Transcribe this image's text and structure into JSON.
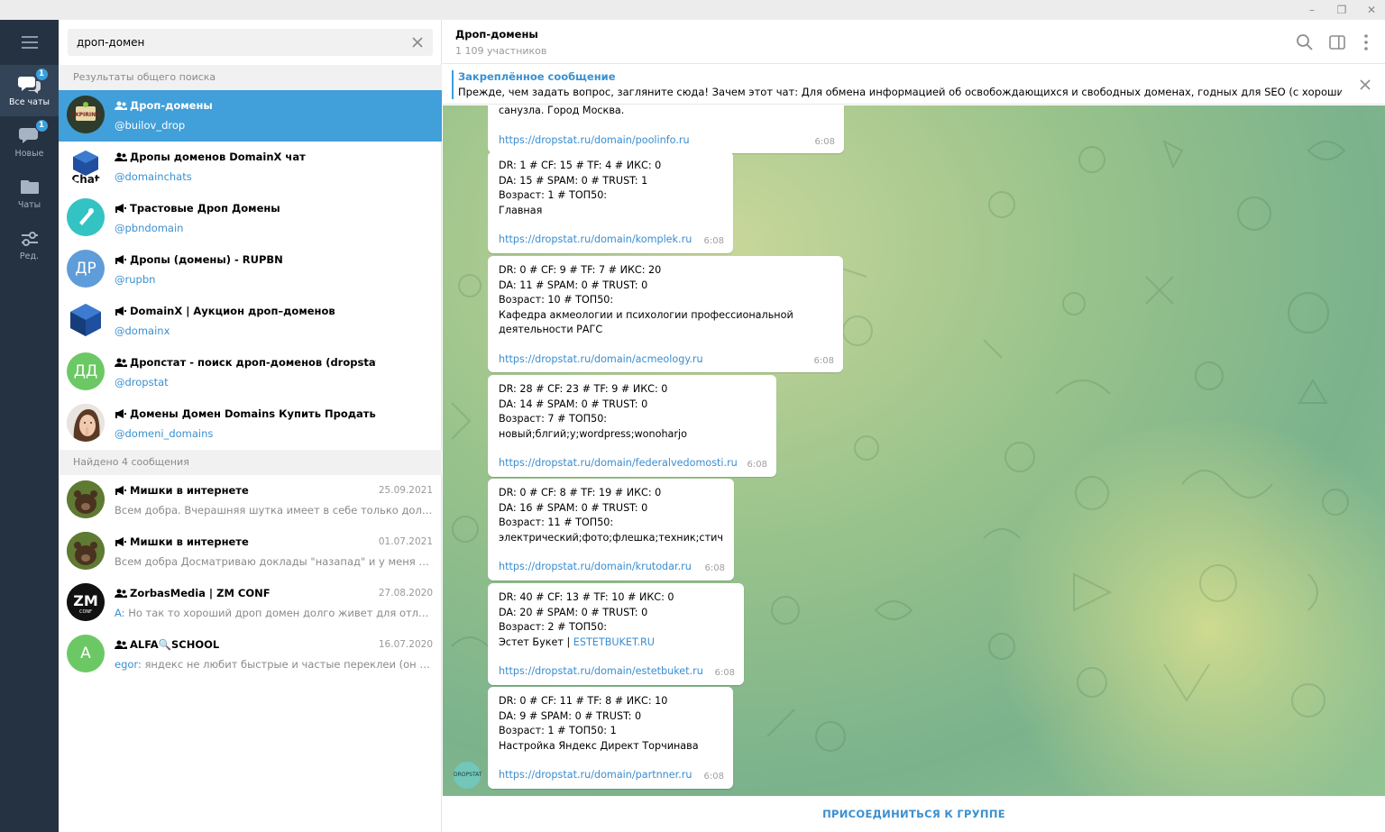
{
  "window": {
    "minimize_glyph": "–",
    "restore_glyph": "❐",
    "close_glyph": "✕"
  },
  "rail": {
    "items": [
      {
        "label": "Все чаты",
        "badge": "1",
        "icon": "chats-icon"
      },
      {
        "label": "Новые",
        "badge": "1",
        "icon": "chat-bubble-icon"
      },
      {
        "label": "Чаты",
        "icon": "folder-icon"
      },
      {
        "label": "Ред.",
        "icon": "filters-edit-icon"
      }
    ]
  },
  "search": {
    "query": "дроп-домен"
  },
  "global_results": {
    "header": "Результаты общего поиска",
    "items": [
      {
        "title": "Дроп-домены",
        "kind": "group",
        "handle": "@builov_drop",
        "avatar_text": "EXPIRING",
        "avatar_color": "#2f3b2b"
      },
      {
        "title": "Дропы доменов DomainX чат",
        "kind": "group",
        "handle": "@domainchats",
        "avatar_text": "Chat",
        "avatar_color": "#ffffff"
      },
      {
        "title": "Трастовые Дроп Домены",
        "kind": "channel",
        "handle": "@pbndomain",
        "avatar_text": "",
        "avatar_color": "#33c3c3"
      },
      {
        "title": "Дропы (домены) - RUPBN",
        "kind": "channel",
        "handle": "@rupbn",
        "avatar_text": "ДР",
        "avatar_color": "#5e9dd9"
      },
      {
        "title": "DomainX | Аукцион дроп–доменов",
        "kind": "channel",
        "handle": "@domainx",
        "avatar_text": "",
        "avatar_color": "#ffffff"
      },
      {
        "title": "Дропстат - поиск дроп-доменов (dropstat.ru)",
        "kind": "group",
        "handle": "@dropstat",
        "avatar_text": "ДД",
        "avatar_color": "#6cc865"
      },
      {
        "title": "Домены Домен Domains Купить Продать Дропы",
        "kind": "channel",
        "handle": "@domeni_domains",
        "avatar_text": "",
        "avatar_color": "#e6c3ad"
      }
    ]
  },
  "messages_results": {
    "header": "Найдено 4 сообщения",
    "items": [
      {
        "title": "Мишки в интернете",
        "kind": "channel",
        "date": "25.09.2021",
        "from": "",
        "text": "Всем добра.  Вчерашняя шутка имеет в себе только долю ш...",
        "avatar_color": "#6b7a3a"
      },
      {
        "title": "Мишки в интернете",
        "kind": "channel",
        "date": "01.07.2021",
        "from": "",
        "text": "Всем добра  Досматриваю доклады \"назапад\" и у меня небо...",
        "avatar_color": "#6b7a3a"
      },
      {
        "title": "ZorbasMedia | ZM CONF",
        "kind": "group",
        "date": "27.08.2020",
        "from": "A:",
        "text": " Но так то хороший дроп домен долго живет для отлива ф...",
        "avatar_text": "ZM",
        "avatar_color": "#111111"
      },
      {
        "title": "ALFA🔍SCHOOL",
        "kind": "group",
        "date": "16.07.2020",
        "from": "egor:",
        "text": " яндекс не любит быстрые и частые переклеи (он на не...",
        "avatar_text": "A",
        "avatar_color": "#6cc865"
      }
    ]
  },
  "chat": {
    "title": "Дроп-домены",
    "members": "1 109 участников",
    "pinned_title": "Закреплённое сообщение",
    "pinned_text": "Прежде, чем задать вопрос, загляните сюда!  Зачем этот чат: Для обмена информацией об освобождающихся и свободных доменах, годных для SEO (с хорошими бэкл...",
    "sender_avatar": "DROPSTAT",
    "join_label": "ПРИСОЕДИНИТЬСЯ К ГРУППЕ",
    "messages": [
      {
        "lines": [
          "санузла. Город Москва."
        ],
        "link": "https://dropstat.ru/domain/poolinfo.ru",
        "time": "6:08"
      },
      {
        "lines": [
          "DR: 1 # CF: 15 # TF: 4 # ИКС: 0",
          "DA: 15 # SPAM: 0 # TRUST: 1",
          "Возраст: 1 # ТОП50:",
          "Главная"
        ],
        "link": "https://dropstat.ru/domain/komplek.ru",
        "time": "6:08"
      },
      {
        "lines": [
          "DR: 0 # CF: 9 # TF: 7 # ИКС: 20",
          "DA: 11 # SPAM: 0 # TRUST: 0",
          "Возраст: 10 # ТОП50:",
          "Кафедра акмеологии и психологии профессиональной",
          "деятельности РАГС"
        ],
        "link": "https://dropstat.ru/domain/acmeology.ru",
        "time": "6:08"
      },
      {
        "lines": [
          "DR: 28 # CF: 23 # TF: 9 # ИКС: 0",
          "DA: 14 # SPAM: 0 # TRUST: 0",
          "Возраст: 7 # ТОП50:",
          "новый;блгий;у;wordpress;wonoharjo"
        ],
        "link": "https://dropstat.ru/domain/federalvedomosti.ru",
        "time": "6:08"
      },
      {
        "lines": [
          "DR: 0 # CF: 8 # TF: 19 # ИКС: 0",
          "DA: 16 # SPAM: 0 # TRUST: 0",
          "Возраст: 11 # ТОП50:",
          "электрический;фото;флешка;техник;стич"
        ],
        "link": "https://dropstat.ru/domain/krutodar.ru",
        "time": "6:08"
      },
      {
        "lines": [
          "DR: 40 # CF: 13 # TF: 10 # ИКС: 0",
          "DA: 20 # SPAM: 0 # TRUST: 0",
          "Возраст: 2 # ТОП50:"
        ],
        "extra_prefix": "Эстет Букет |    ",
        "extra_link": "ESTETBUKET.RU",
        "link": "https://dropstat.ru/domain/estetbuket.ru",
        "time": "6:08"
      },
      {
        "lines": [
          "DR: 0 # CF: 11 # TF: 8 # ИКС: 10",
          "DA: 9 # SPAM: 0 # TRUST: 0",
          "Возраст: 1 # ТОП50: 1",
          "Настройка Яндекс Директ Торчинава"
        ],
        "link": "https://dropstat.ru/domain/partnner.ru",
        "time": "6:08"
      }
    ]
  }
}
